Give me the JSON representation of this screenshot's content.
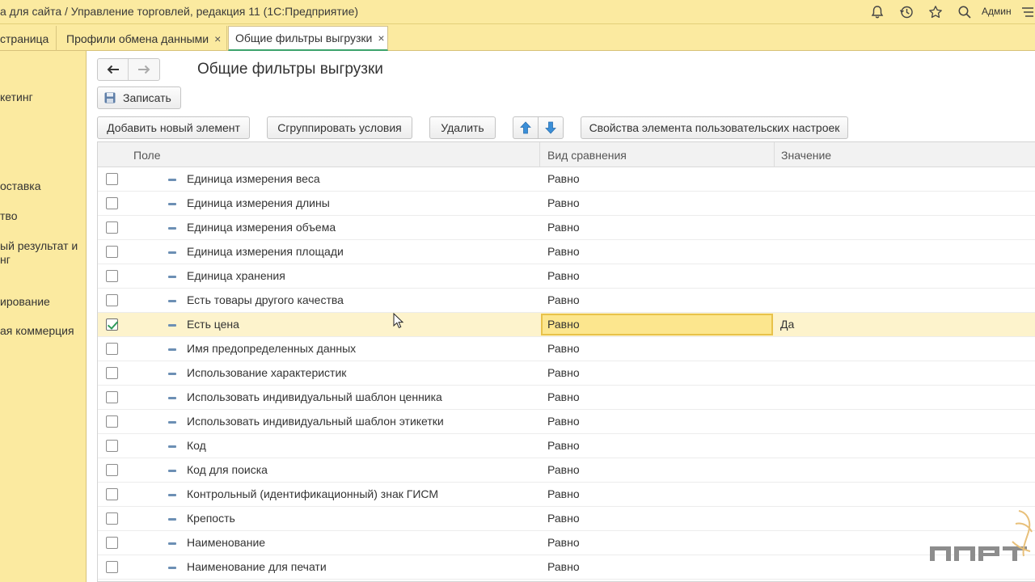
{
  "window": {
    "title": "а для сайта / Управление торговлей, редакция 11  (1С:Предприятие)",
    "user": "Админ"
  },
  "tabs": [
    {
      "label": "страница",
      "closable": false
    },
    {
      "label": "Профили обмена данными",
      "closable": true
    },
    {
      "label": "Общие фильтры выгрузки",
      "closable": true,
      "active": true
    }
  ],
  "tab_close_glyph": "×",
  "sidebar": {
    "items": [
      "кетинг",
      "оставка",
      "тво",
      "ый результат и",
      "нг",
      "ирование",
      "ая коммерция"
    ]
  },
  "page": {
    "title": "Общие фильтры выгрузки",
    "save_label": "Записать"
  },
  "toolbar": {
    "add_label": "Добавить новый элемент",
    "group_label": "Сгруппировать условия",
    "delete_label": "Удалить",
    "properties_label": "Свойства элемента пользовательских настроек"
  },
  "table": {
    "columns": [
      "Поле",
      "Вид сравнения",
      "Значение"
    ],
    "rows": [
      {
        "field": "Единица измерения веса",
        "comparison": "Равно",
        "value": "",
        "checked": false
      },
      {
        "field": "Единица измерения длины",
        "comparison": "Равно",
        "value": "",
        "checked": false
      },
      {
        "field": "Единица измерения объема",
        "comparison": "Равно",
        "value": "",
        "checked": false
      },
      {
        "field": "Единица измерения площади",
        "comparison": "Равно",
        "value": "",
        "checked": false
      },
      {
        "field": "Единица хранения",
        "comparison": "Равно",
        "value": "",
        "checked": false
      },
      {
        "field": "Есть товары другого качества",
        "comparison": "Равно",
        "value": "",
        "checked": false
      },
      {
        "field": "Есть цена",
        "comparison": "Равно",
        "value": "Да",
        "checked": true,
        "selected": true
      },
      {
        "field": "Имя предопределенных данных",
        "comparison": "Равно",
        "value": "",
        "checked": false
      },
      {
        "field": "Использование характеристик",
        "comparison": "Равно",
        "value": "",
        "checked": false
      },
      {
        "field": "Использовать индивидуальный шаблон ценника",
        "comparison": "Равно",
        "value": "",
        "checked": false
      },
      {
        "field": "Использовать индивидуальный шаблон этикетки",
        "comparison": "Равно",
        "value": "",
        "checked": false
      },
      {
        "field": "Код",
        "comparison": "Равно",
        "value": "",
        "checked": false
      },
      {
        "field": "Код для поиска",
        "comparison": "Равно",
        "value": "",
        "checked": false
      },
      {
        "field": "Контрольный (идентификационный) знак ГИСМ",
        "comparison": "Равно",
        "value": "",
        "checked": false
      },
      {
        "field": "Крепость",
        "comparison": "Равно",
        "value": "",
        "checked": false
      },
      {
        "field": "Наименование",
        "comparison": "Равно",
        "value": "",
        "checked": false
      },
      {
        "field": "Наименование для печати",
        "comparison": "Равно",
        "value": "",
        "checked": false
      }
    ]
  },
  "icons": {
    "titlebar": [
      "bell-icon",
      "history-icon",
      "star-icon",
      "search-icon",
      "menu-icon"
    ],
    "nav": [
      "back-arrow-icon",
      "forward-arrow-icon"
    ],
    "move": [
      "move-up-icon",
      "move-down-icon"
    ],
    "row_marker": "minus-icon",
    "save": "floppy-disk-icon"
  },
  "colors": {
    "panel_yellow": "#fbeaa0",
    "selected_row": "#fdf3cc",
    "selected_cell": "#fce68e",
    "active_tab_underline": "#3ca36c",
    "arrow_blue": "#3b8fd8"
  }
}
